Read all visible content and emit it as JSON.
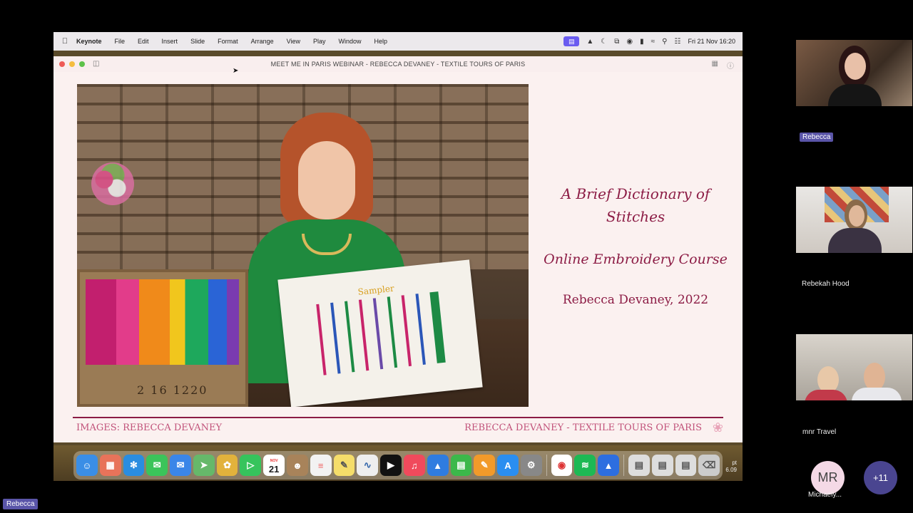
{
  "menubar": {
    "app": "Keynote",
    "items": [
      "File",
      "Edit",
      "Insert",
      "Slide",
      "Format",
      "Arrange",
      "View",
      "Play",
      "Window",
      "Help"
    ],
    "clock": "Fri 21 Nov 16:20"
  },
  "window": {
    "title": "MEET ME IN PARIS WEBINAR - REBECCA DEVANEY - TEXTILE TOURS OF PARIS"
  },
  "slide": {
    "title_line1": "A Brief Dictionary of",
    "title_line2": "Stitches",
    "subtitle": "Online Embroidery Course",
    "author": "Rebecca Devaney, 2022",
    "footer_left": "IMAGES: REBECCA DEVANEY",
    "footer_right": "REBECCA DEVANEY - TEXTILE TOURS OF PARIS",
    "photo": {
      "box_label": "2 16  1220",
      "sampler_label": "Sampler"
    }
  },
  "dock": {
    "calendar_month": "NOV",
    "calendar_day": "21",
    "peek_text": "pt\n6.09"
  },
  "participants": [
    {
      "name": "Rebecca"
    },
    {
      "name": "Rebekah Hood"
    },
    {
      "name": "mnr Travel"
    }
  ],
  "overflow": {
    "avatar_initials": "MR",
    "avatar_name": "Michaely...",
    "more_label": "+11"
  },
  "speaker": {
    "name": "Rebecca"
  },
  "colors": {
    "slide_accent": "#8c1c45",
    "slide_footer": "#c1527a",
    "badge": "#5a55a8"
  }
}
